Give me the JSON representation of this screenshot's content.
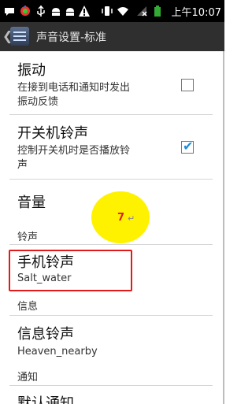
{
  "status_bar": {
    "time": "上午10:07",
    "icons": [
      "chat-icon",
      "app-icon",
      "usb-icon",
      "android-icon",
      "android-debug-icon",
      "warning-icon",
      "vibrate-icon",
      "wifi-icon",
      "no-signal-icon",
      "battery-icon"
    ]
  },
  "action_bar": {
    "back": "❮",
    "title": "声音设置-标准"
  },
  "settings": {
    "vibrate": {
      "title": "振动",
      "subtitle_line1": "在接到电话和通知时发出",
      "subtitle_line2": "振动反馈",
      "checked": false
    },
    "power_ringtone": {
      "title": "开关机铃声",
      "subtitle_line1": "控制开关机时是否播放铃",
      "subtitle_line2": "声",
      "checked": true
    },
    "volume": {
      "title": "音量"
    },
    "ringtone_section": "铃声",
    "phone_ringtone": {
      "title": "手机铃声",
      "value": "Salt_water"
    },
    "message_section": "信息",
    "message_ringtone": {
      "title": "信息铃声",
      "value": "Heaven_nearby"
    },
    "notification_section": "通知",
    "default_notification": {
      "title": "默认通知"
    }
  },
  "annotation": {
    "step": "7",
    "mark": "↵",
    "circle_color": "#fff200",
    "box_color": "#e11b1b"
  }
}
